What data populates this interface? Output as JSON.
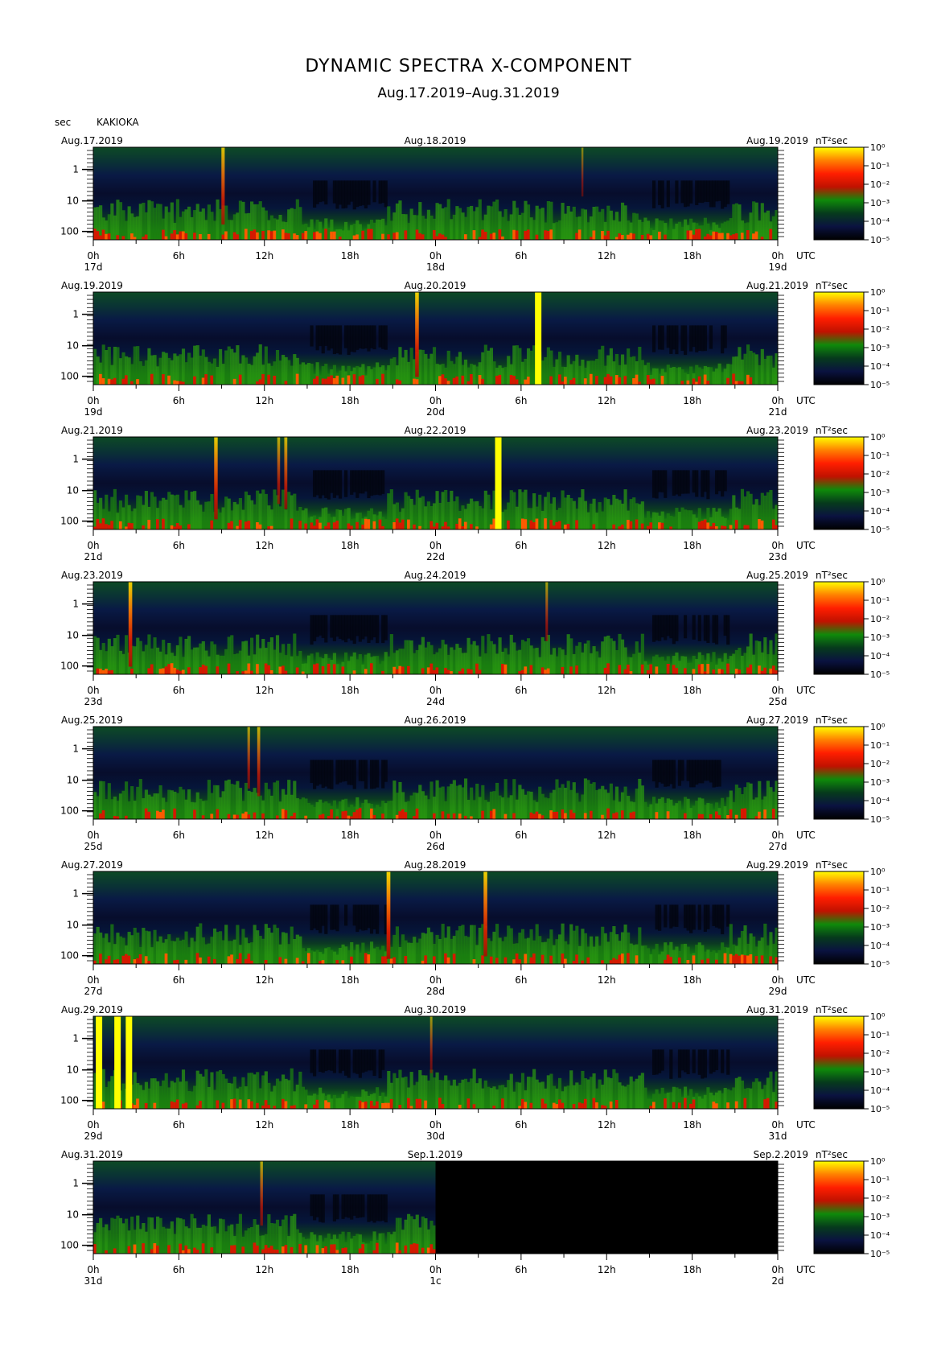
{
  "header": {
    "title": "DYNAMIC SPECTRA X-COMPONENT",
    "subtitle": "Aug.17.2019–Aug.31.2019",
    "unit": "sec",
    "station": "KAKIOKA"
  },
  "chart_data": {
    "type": "heatmap",
    "title": "DYNAMIC SPECTRA X-COMPONENT",
    "subtitle": "Aug.17.2019–Aug.31.2019",
    "ylabel": "sec",
    "y_scale": "log",
    "y_ticks": [
      "1",
      "10",
      "100"
    ],
    "x_ticks": [
      "0h",
      "6h",
      "12h",
      "18h",
      "0h",
      "6h",
      "12h",
      "18h",
      "0h"
    ],
    "x_unit": "UTC",
    "colorbar_unit": "nT²sec",
    "colorbar_ticks": [
      "10⁰",
      "10⁻¹",
      "10⁻²",
      "10⁻³",
      "10⁻⁴",
      "10⁻⁵"
    ],
    "colormap": [
      "#ffff00",
      "#ff8000",
      "#ff1e00",
      "#c01200",
      "#0f8a0a",
      "#063a1c",
      "#0a1240",
      "#000000"
    ],
    "panels": [
      {
        "date_left": "Aug.17.2019",
        "date_mid": "Aug.18.2019",
        "date_right": "Aug.19.2019",
        "day_left": "17d",
        "day_mid": "18d",
        "day_right": "19d",
        "data_ends_hour": 48,
        "events": [
          {
            "hour": 9.1,
            "strength": 0.7
          },
          {
            "hour": 34.3,
            "strength": 0.15
          }
        ]
      },
      {
        "date_left": "Aug.19.2019",
        "date_mid": "Aug.20.2019",
        "date_right": "Aug.21.2019",
        "day_left": "19d",
        "day_mid": "20d",
        "day_right": "21d",
        "data_ends_hour": 48,
        "events": [
          {
            "hour": 22.7,
            "strength": 0.85
          },
          {
            "hour": 31.2,
            "strength": 1.0
          }
        ]
      },
      {
        "date_left": "Aug.21.2019",
        "date_mid": "Aug.22.2019",
        "date_right": "Aug.23.2019",
        "day_left": "21d",
        "day_mid": "22d",
        "day_right": "23d",
        "data_ends_hour": 48,
        "events": [
          {
            "hour": 8.6,
            "strength": 0.8
          },
          {
            "hour": 13.0,
            "strength": 0.5
          },
          {
            "hour": 13.5,
            "strength": 0.6
          },
          {
            "hour": 28.4,
            "strength": 1.0
          }
        ]
      },
      {
        "date_left": "Aug.23.2019",
        "date_mid": "Aug.24.2019",
        "date_right": "Aug.25.2019",
        "day_left": "23d",
        "day_mid": "24d",
        "day_right": "25d",
        "data_ends_hour": 48,
        "events": [
          {
            "hour": 2.6,
            "strength": 0.85
          },
          {
            "hour": 31.8,
            "strength": 0.35
          }
        ]
      },
      {
        "date_left": "Aug.25.2019",
        "date_mid": "Aug.26.2019",
        "date_right": "Aug.27.2019",
        "day_left": "25d",
        "day_mid": "26d",
        "day_right": "27d",
        "data_ends_hour": 48,
        "events": [
          {
            "hour": 10.9,
            "strength": 0.4
          },
          {
            "hour": 11.6,
            "strength": 0.55
          }
        ]
      },
      {
        "date_left": "Aug.27.2019",
        "date_mid": "Aug.28.2019",
        "date_right": "Aug.29.2019",
        "day_left": "27d",
        "day_mid": "28d",
        "day_right": "29d",
        "data_ends_hour": 48,
        "events": [
          {
            "hour": 20.7,
            "strength": 0.9
          },
          {
            "hour": 27.5,
            "strength": 0.85
          }
        ]
      },
      {
        "date_left": "Aug.29.2019",
        "date_mid": "Aug.30.2019",
        "date_right": "Aug.31.2019",
        "day_left": "29d",
        "day_mid": "30d",
        "day_right": "31d",
        "data_ends_hour": 48,
        "events": [
          {
            "hour": 0.4,
            "strength": 1.0
          },
          {
            "hour": 1.7,
            "strength": 1.0
          },
          {
            "hour": 2.5,
            "strength": 1.0
          },
          {
            "hour": 23.7,
            "strength": 0.3
          }
        ]
      },
      {
        "date_left": "Aug.31.2019",
        "date_mid": "Sep.1.2019",
        "date_right": "Sep.2.2019",
        "day_left": "31d",
        "day_mid": "1c",
        "day_right": "2d",
        "data_ends_hour": 24,
        "events": [
          {
            "hour": 11.8,
            "strength": 0.45
          }
        ]
      }
    ]
  }
}
